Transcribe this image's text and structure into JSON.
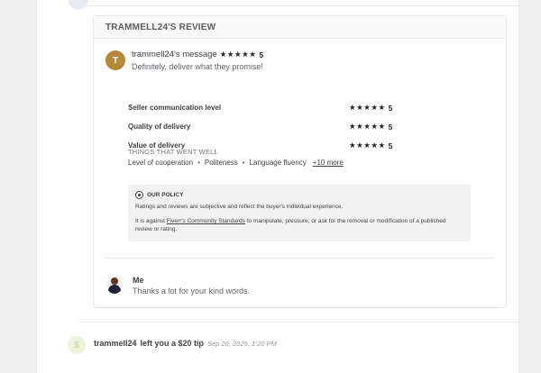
{
  "review": {
    "header": "TRAMMELL24'S REVIEW",
    "avatar_initial": "T",
    "message_title": "trammell24's message",
    "message_stars": "★★★★★",
    "message_score": "5",
    "message_text": "Definitely, deliver what they promise!",
    "ratings": [
      {
        "label": "Seller communication level",
        "stars": "★★★★★",
        "score": "5"
      },
      {
        "label": "Quality of delivery",
        "stars": "★★★★★",
        "score": "5"
      },
      {
        "label": "Value of delivery",
        "stars": "★★★★★",
        "score": "5"
      }
    ],
    "went_well": {
      "title": "THINGS THAT WENT WELL",
      "items": [
        "Level of cooperation",
        "Politeness",
        "Language fluency"
      ],
      "more": "+10 more"
    },
    "policy": {
      "title": "OUR POLICY",
      "line1": "Ratings and reviews are subjective and reflect the buyer's individual experience.",
      "line2_pre": "It is against",
      "line2_link": "Fiverr's Community Standards",
      "line2_post": "to manipulate, pressure, or ask for the removal or modification of a published review or rating."
    },
    "reply": {
      "name": "Me",
      "text": "Thanks a lot for your kind words."
    }
  },
  "tip": {
    "icon": "$",
    "user": "trammell24",
    "text": "left you a $20 tip",
    "date": "Sep 26, 2025, 1:20 PM"
  }
}
